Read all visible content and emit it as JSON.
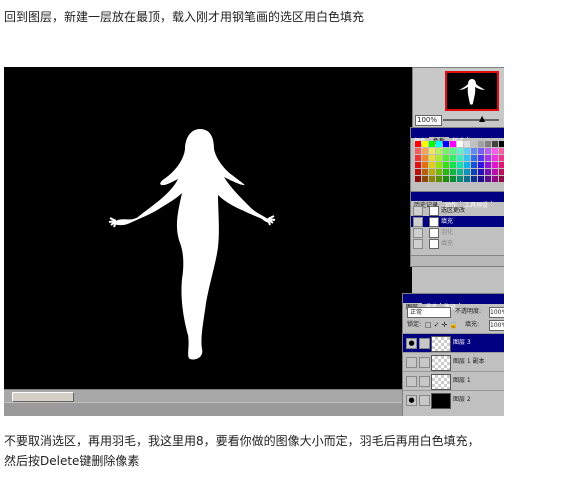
{
  "captions": {
    "top": "回到图层，新建一层放在最顶，载入刚才用钢笔画的选区用白色填充",
    "bottom_line1": "不要取消选区，再用羽毛，我这里用8，要看你做的图像大小而定，羽毛后再用白色填充，",
    "bottom_line2": "然后按Delete键删除像素"
  },
  "navigator": {
    "zoom": "100%"
  },
  "swatches_panel": {
    "tabs": [
      "颜色",
      "色板",
      "样式"
    ],
    "active_tab": 1
  },
  "history_panel": {
    "tabs": [
      "历史记录",
      "动作",
      "工具预设"
    ],
    "items": [
      {
        "label": "选区更改",
        "selected": false,
        "dim": false
      },
      {
        "label": "填充",
        "selected": true,
        "dim": false
      },
      {
        "label": "羽化",
        "selected": false,
        "dim": true
      },
      {
        "label": "填充",
        "selected": false,
        "dim": true
      }
    ]
  },
  "layers_panel": {
    "tabs": [
      "图层",
      "通道",
      "路径"
    ],
    "blend_mode": "正常",
    "opacity_label": "不透明度:",
    "opacity_value": "100%",
    "lock_label": "锁定:",
    "lock_icons": "□✓✛🔒",
    "fill_label": "填充:",
    "fill_value": "100%",
    "layers": [
      {
        "name": "图层 3",
        "selected": true,
        "visible": true,
        "thumb": "checker"
      },
      {
        "name": "图层 1 副本",
        "selected": false,
        "visible": false,
        "thumb": "checker"
      },
      {
        "name": "图层 1",
        "selected": false,
        "visible": false,
        "thumb": "checker"
      },
      {
        "name": "图层 2",
        "selected": false,
        "visible": true,
        "thumb": "black"
      }
    ]
  },
  "colors": {
    "canvas_bg": "#000000",
    "selection_fill": "#ffffff",
    "panel_bg": "#c0c0c0",
    "selected_row": "#000080",
    "nav_frame": "#e01010"
  },
  "icons": {
    "visibility": "eye-icon",
    "lock": "lock-icon"
  }
}
